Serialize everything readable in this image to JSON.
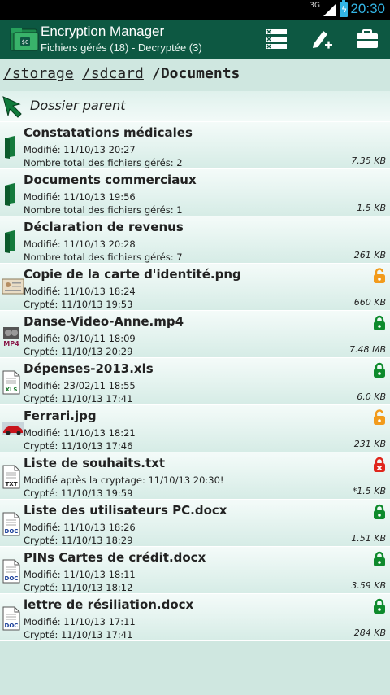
{
  "status": {
    "network": "3G",
    "time": "20:30"
  },
  "header": {
    "title": "Encryption Manager",
    "subtitle": "Fichiers gérés (18) - Decryptée (3)"
  },
  "breadcrumb": [
    "/storage",
    "/sdcard",
    "/Documents"
  ],
  "parent_label": "Dossier parent",
  "files": [
    {
      "name": "Constatations médicales",
      "line1": "Modifié: 11/10/13 20:27",
      "line2": "Nombre total des fichiers gérés: 2",
      "size": "7.35 KB",
      "type": "folder",
      "lock": "none"
    },
    {
      "name": "Documents commerciaux",
      "line1": "Modifié: 11/10/13 19:56",
      "line2": "Nombre total des fichiers gérés: 1",
      "size": "1.5 KB",
      "type": "folder",
      "lock": "none"
    },
    {
      "name": "Déclaration de revenus",
      "line1": "Modifié: 11/10/13 20:28",
      "line2": "Nombre total des fichiers gérés: 7",
      "size": "261 KB",
      "type": "folder",
      "lock": "none"
    },
    {
      "name": "Copie de la carte d'identité.png",
      "line1": "Modifié: 11/10/13 18:24",
      "line2": "Crypté: 11/10/13 19:53",
      "size": "660 KB",
      "type": "image-id",
      "lock": "unlocked"
    },
    {
      "name": "Danse-Video-Anne.mp4",
      "line1": "Modifié: 03/10/11 18:09",
      "line2": "Crypté: 11/10/13 20:29",
      "size": "7.48 MB",
      "type": "video",
      "lock": "locked"
    },
    {
      "name": "Dépenses-2013.xls",
      "line1": "Modifié: 23/02/11 18:55",
      "line2": "Crypté: 11/10/13 17:41",
      "size": "6.0 KB",
      "type": "xls",
      "lock": "locked"
    },
    {
      "name": "Ferrari.jpg",
      "line1": "Modifié: 11/10/13 18:21",
      "line2": "Crypté: 11/10/13 17:46",
      "size": "231 KB",
      "type": "image-car",
      "lock": "unlocked"
    },
    {
      "name": "Liste de souhaits.txt",
      "line1": "Modifié après la cryptage: 11/10/13 20:30!",
      "line2": "Crypté: 11/10/13 19:59",
      "size": "*1.5 KB",
      "type": "txt",
      "lock": "error"
    },
    {
      "name": "Liste des utilisateurs PC.docx",
      "line1": "Modifié: 11/10/13 18:26",
      "line2": "Crypté: 11/10/13 18:29",
      "size": "1.51 KB",
      "type": "doc",
      "lock": "locked"
    },
    {
      "name": "PINs Cartes de crédit.docx",
      "line1": "Modifié: 11/10/13 18:11",
      "line2": "Crypté: 11/10/13 18:12",
      "size": "3.59 KB",
      "type": "doc",
      "lock": "locked"
    },
    {
      "name": "lettre de résiliation.docx",
      "line1": "Modifié: 11/10/13 17:11",
      "line2": "Crypté: 11/10/13 17:41",
      "size": "284 KB",
      "type": "doc",
      "lock": "locked"
    }
  ],
  "icon_labels": {
    "txt": "TXT",
    "doc": "DOC",
    "xls": "XLS",
    "mp4": "MP4"
  },
  "colors": {
    "action_bar": "#0d5842",
    "lock_green": "#0e8a2c",
    "lock_orange": "#f29b1c",
    "lock_red": "#e0261c",
    "folder_green": "#147a3c"
  }
}
